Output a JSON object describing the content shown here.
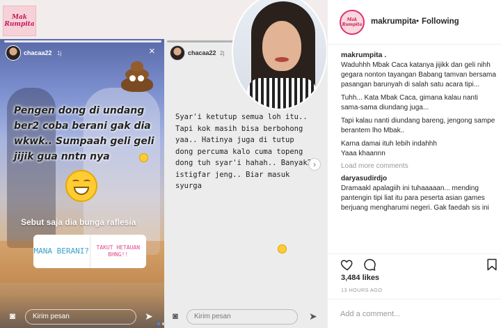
{
  "post": {
    "logo_text": "Mak Rumpita",
    "username": "makrumpita",
    "separator": "•",
    "follow_status": "Following",
    "caption_user": "makrumpita .",
    "caption_lines": [
      "Waduhhh Mbak Caca katanya jijikk dan geli nihh gegara nonton tayangan Babang tamvan bersama pasangan barunyah di salah satu acara tipi...",
      "Tuhh... Kata Mbak Caca, gimana kalau nanti sama-sama diundang juga...",
      "Tapi kalau nanti diundang bareng, jengong sampe berantem lho Mbak..",
      "Karna damai ituh lebih indahhh\nYaaa khaannn"
    ],
    "load_more": "Load more comments",
    "comment": {
      "user": "daryasudirdjo",
      "text": "Dramaakl apalagiih ini tuhaaaaan... mending pantengin tipi liat itu para peserta asian games berjuang mengharumi negeri. Gak faedah sis ini"
    },
    "likes": "3,484 likes",
    "time_ago": "13 HOURS AGO",
    "add_comment_placeholder": "Add a comment..."
  },
  "story1": {
    "username": "chacaa22",
    "time": "1j",
    "main_text": "Pengen dong di undang ber2 coba berani gak dia wkwk.. Sumpaah geli geli jijik gua nntn nya",
    "sub_text": "Sebut saja dia bunga raflesia",
    "poll_option_1": "MANA BERANI?",
    "poll_option_2": "TAKUT HETAUAN BHNG!!",
    "reply_placeholder": "Kirim pesan"
  },
  "story2": {
    "username": "chacaa22",
    "time": "2j",
    "text": "Syar'i ketutup semua loh itu.. Tapi kok masih bisa berbohong yaa.. Hatinya juga di tutup dong percuma kalo cuma topeng dong tuh syar'i hahah.. Banyak2 istigfar jeng.. Biar masuk syurga",
    "reply_placeholder": "Kirim pesan"
  },
  "icons": {
    "close": "×",
    "next": "›",
    "camera": "◙",
    "send": "➤"
  },
  "colors": {
    "brand_pink": "#e1306c",
    "poll_blue": "#3aa0c8",
    "poll_pink": "#e0498a",
    "muted": "#999999"
  }
}
